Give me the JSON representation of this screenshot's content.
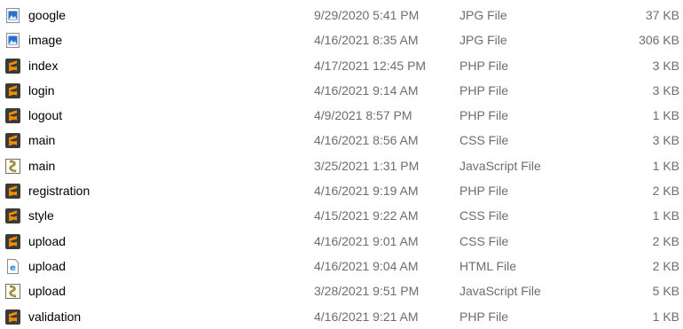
{
  "colors": {
    "meta_text": "#6d6d6d",
    "sublime_orange": "#ef8e00",
    "sublime_dark": "#3a3a3a",
    "jpg_blue": "#2a6fc9",
    "edge_blue": "#1f8fd6",
    "js_yellow": "#f2d43b"
  },
  "files": [
    {
      "icon": "jpg-image-icon",
      "name": "google",
      "date": "9/29/2020 5:41 PM",
      "type": "JPG File",
      "size": "37 KB"
    },
    {
      "icon": "jpg-image-icon",
      "name": "image",
      "date": "4/16/2021 8:35 AM",
      "type": "JPG File",
      "size": "306 KB"
    },
    {
      "icon": "sublime-text-icon",
      "name": "index",
      "date": "4/17/2021 12:45 PM",
      "type": "PHP File",
      "size": "3 KB"
    },
    {
      "icon": "sublime-text-icon",
      "name": "login",
      "date": "4/16/2021 9:14 AM",
      "type": "PHP File",
      "size": "3 KB"
    },
    {
      "icon": "sublime-text-icon",
      "name": "logout",
      "date": "4/9/2021 8:57 PM",
      "type": "PHP File",
      "size": "1 KB"
    },
    {
      "icon": "sublime-text-icon",
      "name": "main",
      "date": "4/16/2021 8:56 AM",
      "type": "CSS File",
      "size": "3 KB"
    },
    {
      "icon": "javascript-script-icon",
      "name": "main",
      "date": "3/25/2021 1:31 PM",
      "type": "JavaScript File",
      "size": "1 KB"
    },
    {
      "icon": "sublime-text-icon",
      "name": "registration",
      "date": "4/16/2021 9:19 AM",
      "type": "PHP File",
      "size": "2 KB"
    },
    {
      "icon": "sublime-text-icon",
      "name": "style",
      "date": "4/15/2021 9:22 AM",
      "type": "CSS File",
      "size": "1 KB"
    },
    {
      "icon": "sublime-text-icon",
      "name": "upload",
      "date": "4/16/2021 9:01 AM",
      "type": "CSS File",
      "size": "2 KB"
    },
    {
      "icon": "edge-html-icon",
      "name": "upload",
      "date": "4/16/2021 9:04 AM",
      "type": "HTML File",
      "size": "2 KB"
    },
    {
      "icon": "javascript-script-icon",
      "name": "upload",
      "date": "3/28/2021 9:51 PM",
      "type": "JavaScript File",
      "size": "5 KB"
    },
    {
      "icon": "sublime-text-icon",
      "name": "validation",
      "date": "4/16/2021 9:21 AM",
      "type": "PHP File",
      "size": "1 KB"
    }
  ]
}
